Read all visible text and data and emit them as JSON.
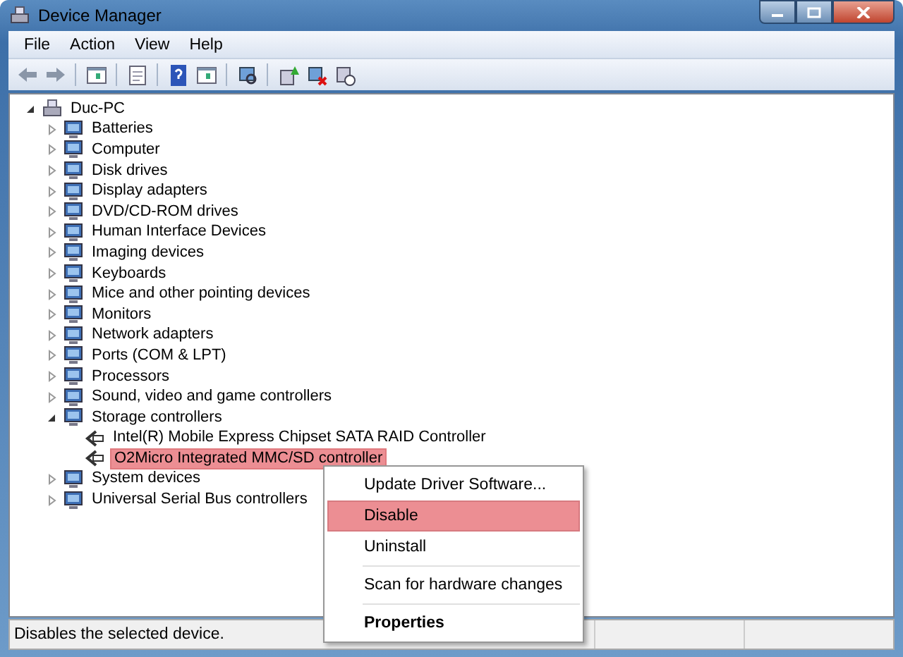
{
  "window": {
    "title": "Device Manager"
  },
  "menu": [
    "File",
    "Action",
    "View",
    "Help"
  ],
  "tree": {
    "label": "Duc-PC",
    "expanded": true,
    "selected": false,
    "children": [
      {
        "label": "Batteries",
        "expanded": false,
        "selected": false
      },
      {
        "label": "Computer",
        "expanded": false,
        "selected": false
      },
      {
        "label": "Disk drives",
        "expanded": false,
        "selected": false
      },
      {
        "label": "Display adapters",
        "expanded": false,
        "selected": false
      },
      {
        "label": "DVD/CD-ROM drives",
        "expanded": false,
        "selected": false
      },
      {
        "label": "Human Interface Devices",
        "expanded": false,
        "selected": false
      },
      {
        "label": "Imaging devices",
        "expanded": false,
        "selected": false
      },
      {
        "label": "Keyboards",
        "expanded": false,
        "selected": false
      },
      {
        "label": "Mice and other pointing devices",
        "expanded": false,
        "selected": false
      },
      {
        "label": "Monitors",
        "expanded": false,
        "selected": false
      },
      {
        "label": "Network adapters",
        "expanded": false,
        "selected": false
      },
      {
        "label": "Ports (COM & LPT)",
        "expanded": false,
        "selected": false
      },
      {
        "label": "Processors",
        "expanded": false,
        "selected": false
      },
      {
        "label": "Sound, video and game controllers",
        "expanded": false,
        "selected": false
      },
      {
        "label": "Storage controllers",
        "expanded": true,
        "selected": false,
        "children": [
          {
            "label": "Intel(R) Mobile Express Chipset SATA RAID Controller",
            "selected": false
          },
          {
            "label": "O2Micro Integrated MMC/SD controller",
            "selected": true
          }
        ]
      },
      {
        "label": "System devices",
        "expanded": false,
        "selected": false
      },
      {
        "label": "Universal Serial Bus controllers",
        "expanded": false,
        "selected": false
      }
    ]
  },
  "context_menu": [
    {
      "kind": "item",
      "label": "Update Driver Software...",
      "selected": false,
      "bold": false
    },
    {
      "kind": "item",
      "label": "Disable",
      "selected": true,
      "bold": false
    },
    {
      "kind": "item",
      "label": "Uninstall",
      "selected": false,
      "bold": false
    },
    {
      "kind": "separator"
    },
    {
      "kind": "item",
      "label": "Scan for hardware changes",
      "selected": false,
      "bold": false
    },
    {
      "kind": "separator"
    },
    {
      "kind": "item",
      "label": "Properties",
      "selected": false,
      "bold": true
    }
  ],
  "status_bar": "Disables the selected device."
}
